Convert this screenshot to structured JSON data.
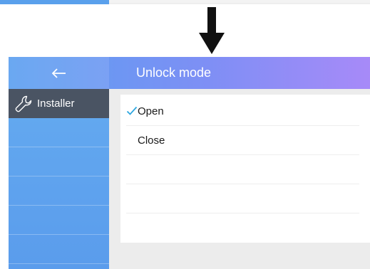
{
  "header": {
    "title": "Unlock mode",
    "back_icon": "arrow-left-icon"
  },
  "sidebar": {
    "items": [
      {
        "label": "Installer",
        "icon": "wrench-icon",
        "active": true
      },
      {
        "label": ""
      },
      {
        "label": ""
      },
      {
        "label": ""
      },
      {
        "label": ""
      },
      {
        "label": ""
      }
    ]
  },
  "options": {
    "items": [
      {
        "label": "Open",
        "selected": true
      },
      {
        "label": "Close",
        "selected": false
      },
      {
        "label": ""
      },
      {
        "label": ""
      }
    ]
  },
  "colors": {
    "header_start": "#5a9ff0",
    "header_end": "#a78af8",
    "sidebar": "#5a9cec",
    "sidebar_active": "#4a5463",
    "check": "#2ea7e0"
  }
}
